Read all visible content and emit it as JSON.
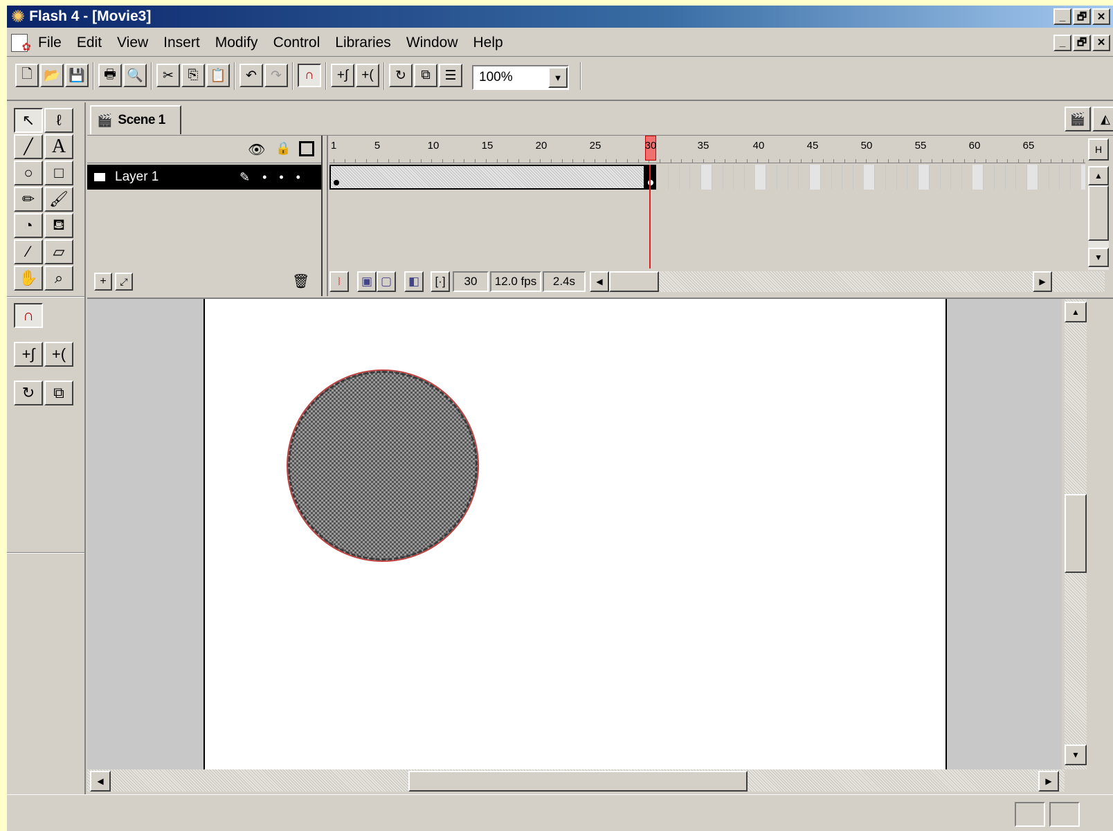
{
  "window": {
    "title": "Flash 4 - [Movie3]",
    "min_glyph": "_",
    "max_glyph": "🗗",
    "close_glyph": "✕"
  },
  "menu": [
    "File",
    "Edit",
    "View",
    "Insert",
    "Modify",
    "Control",
    "Libraries",
    "Window",
    "Help"
  ],
  "toolbar": {
    "zoom_value": "100%"
  },
  "scene": {
    "name": "Scene 1"
  },
  "timeline": {
    "layer_name": "Layer 1",
    "ruler_numbers": [
      "1",
      "5",
      "10",
      "15",
      "20",
      "25",
      "30",
      "35",
      "40",
      "45",
      "50",
      "55",
      "60",
      "65"
    ],
    "current_frame": "30",
    "fps": "12.0 fps",
    "elapsed": "2.4s"
  },
  "colors": {
    "title_gradient_start": "#0a246a",
    "title_gradient_end": "#a6caf0",
    "playhead": "#e02020",
    "chrome": "#d4d0c8",
    "stage": "#ffffff",
    "circle_fill": "#7a7a7a"
  }
}
